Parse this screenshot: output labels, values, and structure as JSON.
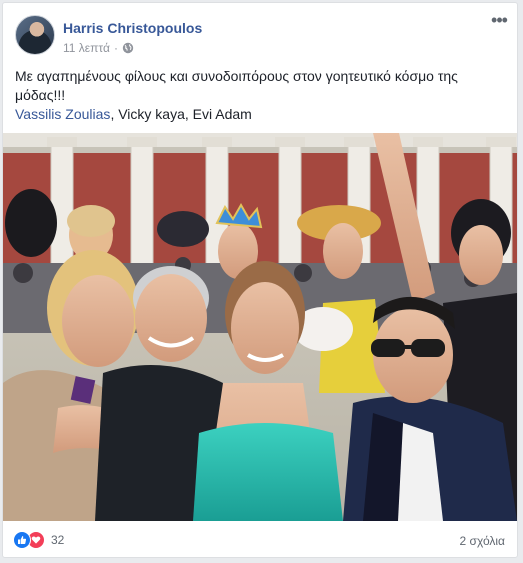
{
  "post": {
    "author": "Harris Christopoulos",
    "timestamp": "11 λεπτά",
    "separator": "·",
    "privacy_icon": "globe-icon",
    "more_icon": "more-options-icon",
    "text": "Με αγαπημένους φίλους και συνοδοιπόρους στον γοητευτικό κόσμο της μόδας!!!",
    "tagged": [
      {
        "name": "Vassilis Zoulias",
        "link": true,
        "sep": ", "
      },
      {
        "name": "Vicky kaya",
        "link": false,
        "sep": ", "
      },
      {
        "name": "Evi Adam",
        "link": false,
        "sep": ""
      }
    ],
    "photo_icon": "group-selfie-photo"
  },
  "footer": {
    "reaction_icons": [
      "like-icon",
      "love-icon"
    ],
    "reaction_count": "32",
    "comments": "2 σχόλια"
  },
  "colors": {
    "link": "#385898",
    "text": "#1d2129",
    "meta": "#90949c",
    "like": "#1877f2",
    "love": "#f33e58",
    "page_bg": "#e9ebee"
  }
}
